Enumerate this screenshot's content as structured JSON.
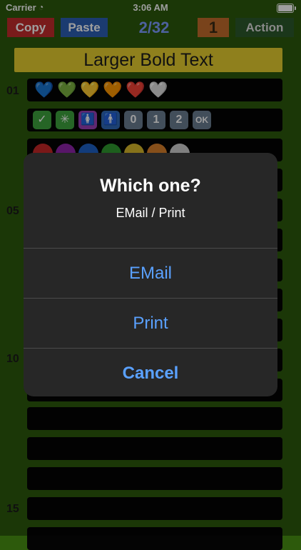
{
  "status": {
    "carrier": "Carrier",
    "time": "3:06 AM"
  },
  "toolbar": {
    "copy_label": "Copy",
    "paste_label": "Paste",
    "counter": "2/32",
    "page_number": "1",
    "action_label": "Action"
  },
  "title": "Larger Bold Text",
  "row_labels": {
    "r01": "01",
    "r05": "05",
    "r10": "10",
    "r15": "15"
  },
  "row_items": {
    "hearts": [
      "💙",
      "💚",
      "💛",
      "🧡",
      "❤️",
      "🤍"
    ],
    "symbols": [
      "✓",
      "✳",
      "🚺",
      "🚹",
      "0",
      "1",
      "2",
      "OK"
    ],
    "circles_colors": [
      "#c62828",
      "#8e24aa",
      "#1e62c7",
      "#2f9a2f",
      "#d9b92b",
      "#d9802b",
      "#cfcfcf"
    ]
  },
  "dialog": {
    "title": "Which one?",
    "message": "EMail / Print",
    "buttons": {
      "email": "EMail",
      "print": "Print",
      "cancel": "Cancel"
    }
  },
  "colors": {
    "background": "#2d5a0c",
    "copy": "#c42d2d",
    "paste": "#2d5fb5",
    "counter": "#7c9dff",
    "page_button": "#c46c2d",
    "action": "#2d5a2d",
    "title_bar": "#e7cf2f",
    "dialog_button_text": "#5aa1ff"
  }
}
